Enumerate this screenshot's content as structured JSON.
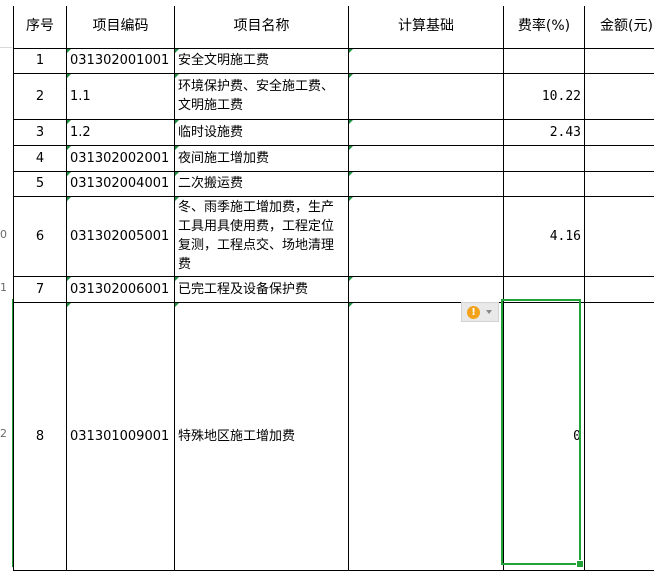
{
  "header": {
    "seq": "序号",
    "code": "项目编码",
    "name": "项目名称",
    "basis": "计算基础",
    "rate": "费率(%)",
    "amount": "金额(元)"
  },
  "row_headers": [
    "0",
    "1",
    "2"
  ],
  "rows": [
    {
      "seq": "1",
      "code": "031302001001",
      "name": "安全文明施工费",
      "basis": "",
      "rate": "",
      "amount": ""
    },
    {
      "seq": "2",
      "code": "1.1",
      "name": "环境保护费、安全施工费、文明施工费",
      "basis": "",
      "rate": "10.22",
      "amount": ""
    },
    {
      "seq": "3",
      "code": "1.2",
      "name": "临时设施费",
      "basis": "",
      "rate": "2.43",
      "amount": ""
    },
    {
      "seq": "4",
      "code": "031302002001",
      "name": "夜间施工增加费",
      "basis": "",
      "rate": "",
      "amount": ""
    },
    {
      "seq": "5",
      "code": "031302004001",
      "name": "二次搬运费",
      "basis": "",
      "rate": "",
      "amount": ""
    },
    {
      "seq": "6",
      "code": "031302005001",
      "name": "冬、雨季施工增加费，生产工具用具使用费，工程定位复测，工程点交、场地清理费",
      "basis": "",
      "rate": "4.16",
      "amount": ""
    },
    {
      "seq": "7",
      "code": "031302006001",
      "name": "已完工程及设备保护费",
      "basis": "",
      "rate": "",
      "amount": ""
    },
    {
      "seq": "8",
      "code": "031301009001",
      "name": "特殊地区施工增加费",
      "basis": "",
      "rate": "0",
      "amount": ""
    }
  ],
  "error_indicator": {
    "icon": "warning-icon",
    "glyph": "!",
    "color": "#f3a21c"
  },
  "colors": {
    "selection": "#21a33a",
    "comment_marker": "#1e8f3c"
  }
}
